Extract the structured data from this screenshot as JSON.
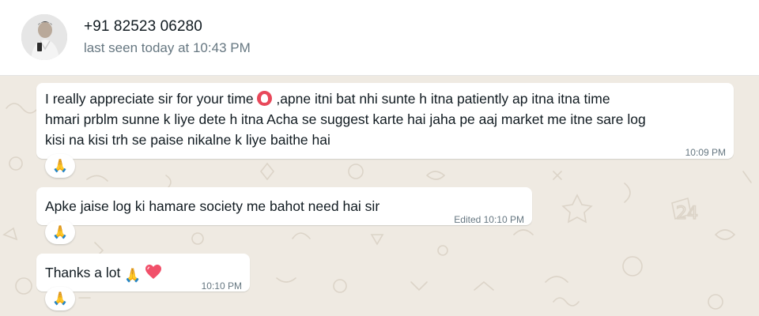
{
  "header": {
    "contact_name": "+91 82523 06280",
    "last_seen": "last seen today at 10:43 PM",
    "avatar_icon": "person-photo-icon"
  },
  "messages": [
    {
      "text_part1": "I really appreciate sir for your time",
      "text_part2": ",apne itni bat nhi sunte h itna patiently ap itna itna time",
      "text_line2": "hmari prblm sunne k liye dete h itna Acha se suggest karte hai jaha pe aaj market me itne sare log",
      "text_line3": "kisi na kisi trh se paise nikalne k liye baithe hai",
      "time": "10:09 PM",
      "reaction": "🙏"
    },
    {
      "text": "Apke jaise log ki hamare society me bahot need hai sir",
      "time": "Edited 10:10 PM",
      "reaction": "🙏"
    },
    {
      "text": "Thanks a lot",
      "time": "10:10 PM",
      "reaction": "🙏"
    }
  ],
  "colors": {
    "chat_background": "#efeae2",
    "bubble": "#ffffff",
    "meta_text": "#667781"
  }
}
